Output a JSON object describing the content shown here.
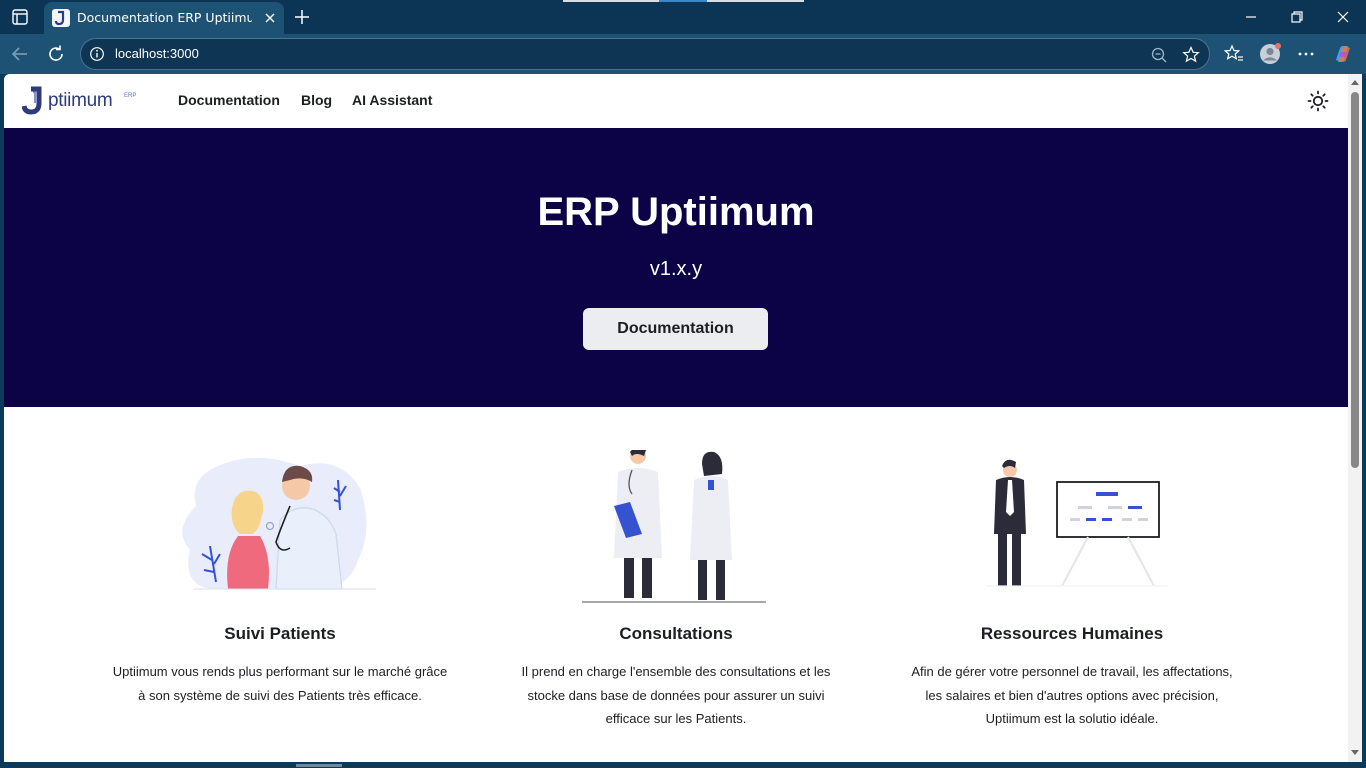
{
  "browser": {
    "tab_title": "Documentation ERP Uptiimum | ERP Uptiimum",
    "url": "localhost:3000"
  },
  "site": {
    "logo_text": "ptiimum",
    "logo_suffix": "ERP",
    "nav": {
      "documentation": "Documentation",
      "blog": "Blog",
      "ai_assistant": "AI Assistant"
    }
  },
  "hero": {
    "title": "ERP Uptiimum",
    "version": "v1.x.y",
    "button": "Documentation",
    "background": "#0b0345"
  },
  "features": [
    {
      "title": "Suivi Patients",
      "text": "Uptiimum vous rends plus performant sur le marché grâce à son système de suivi des Patients très efficace."
    },
    {
      "title": "Consultations",
      "text": "Il prend en charge l'ensemble des consultations et les stocke dans base de données pour assurer un suivi efficace sur les Patients."
    },
    {
      "title": "Ressources Humaines",
      "text": "Afin de gérer votre personnel de travail, les affectations, les salaires et bien d'autres options avec précision, Uptiimum est la solutio idéale."
    }
  ],
  "colors": {
    "accent": "#3553d1",
    "chrome": "#1e5275"
  }
}
